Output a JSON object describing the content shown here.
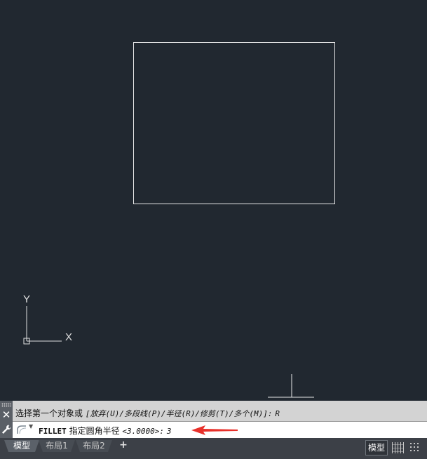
{
  "ucs": {
    "y_label": "Y",
    "x_label": "X"
  },
  "command_history": {
    "prompt": "选择第一个对象或",
    "options": "[放弃(U)/多段线(P)/半径(R)/修剪(T)/多个(M)]:",
    "value": "R"
  },
  "command_line": {
    "icon": "fillet-icon",
    "command": "FILLET",
    "prompt": "指定圆角半径",
    "default": "<3.0000>:",
    "value": "3"
  },
  "tabs": [
    {
      "label": "模型",
      "active": true
    },
    {
      "label": "布局1",
      "active": false
    },
    {
      "label": "布局2",
      "active": false
    }
  ],
  "add_tab_label": "+",
  "statusbar": {
    "model_label": "模型"
  },
  "colors": {
    "canvas": "#212830",
    "geometry": "#e8e8e8",
    "annotation_arrow": "#e8312b",
    "history_bg": "#d3d3d3"
  }
}
